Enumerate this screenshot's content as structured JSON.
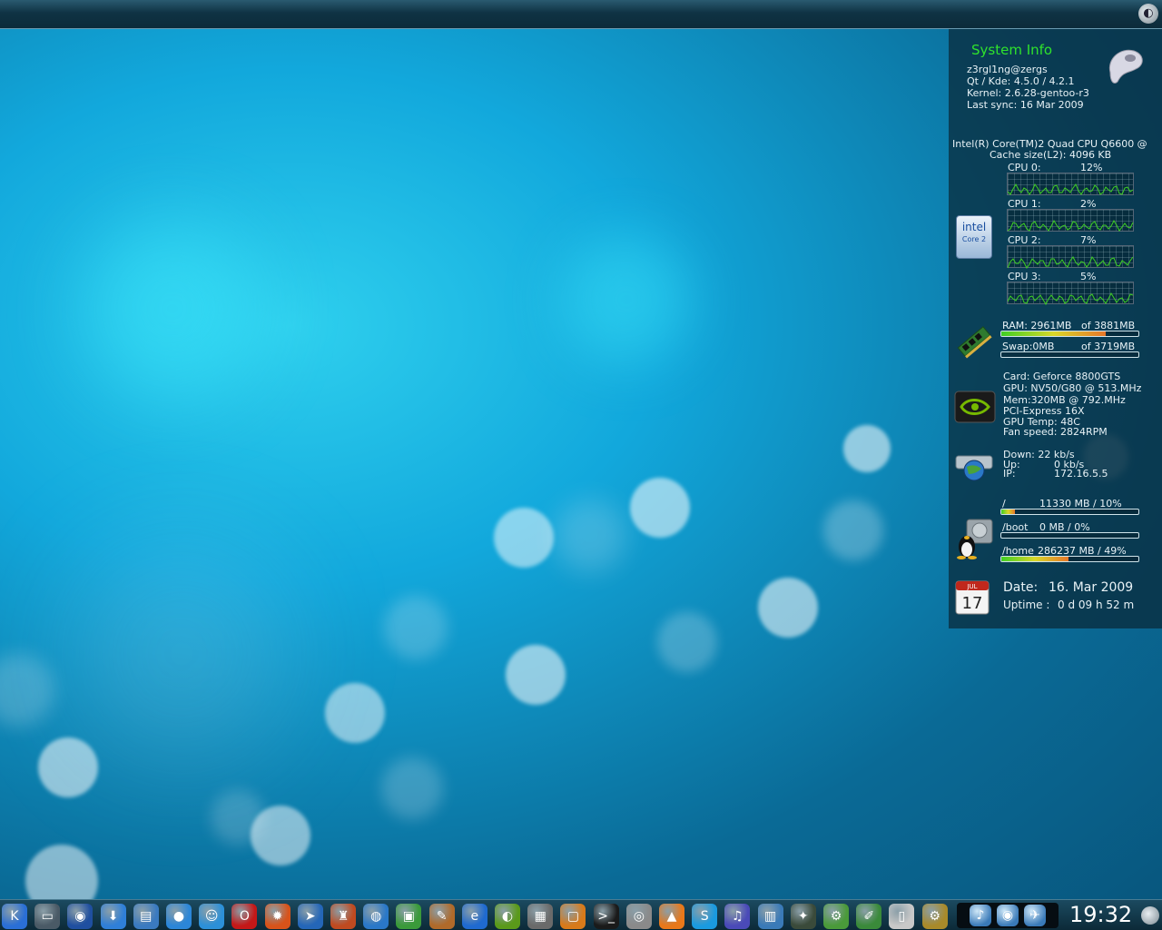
{
  "system_info": {
    "title": "System Info",
    "user": "z3rgl1ng@zergs",
    "qt_kde": "Qt / Kde: 4.5.0  /  4.2.1",
    "kernel": "Kernel:  2.6.28-gentoo-r3",
    "last_sync": "Last sync: 16 Mar 2009"
  },
  "cpu": {
    "model": "Intel(R) Core(TM)2 Quad CPU Q6600 @",
    "cache": "Cache size(L2): 4096 KB",
    "cores": [
      {
        "label": "CPU 0:",
        "usage": "12%"
      },
      {
        "label": "CPU 1:",
        "usage": "2%"
      },
      {
        "label": "CPU 2:",
        "usage": "7%"
      },
      {
        "label": "CPU 3:",
        "usage": "5%"
      }
    ],
    "icon": "intel-core2-icon",
    "badge_brand": "intel",
    "badge_model": "Core 2"
  },
  "memory": {
    "ram_label": "RAM: 2961MB",
    "ram_total": "of 3881MB",
    "ram_fraction": 0.763,
    "swap_label": "Swap:0MB",
    "swap_total": "of 3719MB",
    "swap_fraction": 0.0,
    "icon": "ram-module-icon"
  },
  "gpu": {
    "card": "Card: Geforce 8800GTS",
    "gpu": "GPU: NV50/G80 @ 513.MHz",
    "mem": "Mem:320MB  @ 792.MHz",
    "pci": "PCI-Express  16X",
    "temp": "GPU Temp:  48C",
    "fan": "Fan speed:  2824RPM",
    "icon": "nvidia-icon"
  },
  "network": {
    "down": "Down:  22 kb/s",
    "up_label": "Up:",
    "up_value": "0 kb/s",
    "ip_label": "IP:",
    "ip_value": "172.16.5.5",
    "icon": "network-globe-icon"
  },
  "disks": [
    {
      "mount": "/",
      "info": "11330 MB / 10%",
      "fraction": 0.1
    },
    {
      "mount": "/boot",
      "info": "0 MB / 0%",
      "fraction": 0.0
    },
    {
      "mount": "/home",
      "info": "286237 MB / 49%",
      "fraction": 0.49
    }
  ],
  "date": {
    "date_label": "Date:",
    "date_value": "16. Mar 2009",
    "uptime_label": "Uptime :",
    "uptime_value": "0 d 09 h 52 m",
    "calendar_day": "17",
    "calendar_month": "JUL"
  },
  "taskbar": {
    "clock": "19:32",
    "icons": [
      {
        "name": "kde-menu-icon",
        "glyph": "K",
        "color": "#2a6fd6"
      },
      {
        "name": "desktop-pager-icon",
        "glyph": "▭",
        "color": "#4a5a66"
      },
      {
        "name": "network-browser-icon",
        "glyph": "◉",
        "color": "#1f4fa0"
      },
      {
        "name": "download-icon",
        "glyph": "⬇",
        "color": "#2f7fd8"
      },
      {
        "name": "file-manager-icon",
        "glyph": "▤",
        "color": "#3a7ac0"
      },
      {
        "name": "globe-network-icon",
        "glyph": "●",
        "color": "#2b86d8"
      },
      {
        "name": "chat-icon",
        "glyph": "☺",
        "color": "#2c90d8"
      },
      {
        "name": "opera-icon",
        "glyph": "O",
        "color": "#c41818"
      },
      {
        "name": "firefox-icon",
        "glyph": "✹",
        "color": "#d8531a"
      },
      {
        "name": "messenger-icon",
        "glyph": "➤",
        "color": "#2466b8"
      },
      {
        "name": "game-icon",
        "glyph": "♜",
        "color": "#c04a20"
      },
      {
        "name": "browser-globe-icon",
        "glyph": "◍",
        "color": "#2a78c8"
      },
      {
        "name": "image-viewer-icon",
        "glyph": "▣",
        "color": "#3a9a3a"
      },
      {
        "name": "paint-icon",
        "glyph": "✎",
        "color": "#b06a2a"
      },
      {
        "name": "internet-explorer-icon",
        "glyph": "e",
        "color": "#1f6ad0"
      },
      {
        "name": "nvidia-settings-icon",
        "glyph": "◐",
        "color": "#5a9a1a"
      },
      {
        "name": "calculator-icon",
        "glyph": "▦",
        "color": "#6a6a6a"
      },
      {
        "name": "virtualbox-icon",
        "glyph": "▢",
        "color": "#d87a1a"
      },
      {
        "name": "terminal-icon",
        "glyph": ">_",
        "color": "#1a1a1a"
      },
      {
        "name": "media-disc-icon",
        "glyph": "◎",
        "color": "#8a8a8a"
      },
      {
        "name": "vlc-icon",
        "glyph": "▲",
        "color": "#e8781a"
      },
      {
        "name": "skype-icon",
        "glyph": "S",
        "color": "#1a9ae0"
      },
      {
        "name": "music-player-icon",
        "glyph": "♫",
        "color": "#4a4ab8"
      },
      {
        "name": "remote-desktop-icon",
        "glyph": "▥",
        "color": "#3a7ab8"
      },
      {
        "name": "satellite-icon",
        "glyph": "✦",
        "color": "#3a4a3a"
      },
      {
        "name": "settings-gear-icon",
        "glyph": "⚙",
        "color": "#4a9a3a"
      },
      {
        "name": "pen-tool-icon",
        "glyph": "✐",
        "color": "#3a8a3a"
      },
      {
        "name": "text-editor-icon",
        "glyph": "▯",
        "color": "#c8c8c8"
      },
      {
        "name": "package-manager-icon",
        "glyph": "⚙",
        "color": "#a88a2a"
      }
    ],
    "tray": [
      {
        "name": "volume-icon",
        "glyph": "♪"
      },
      {
        "name": "messenger-tray-icon",
        "glyph": "◉"
      },
      {
        "name": "network-tray-icon",
        "glyph": "✈"
      }
    ]
  }
}
